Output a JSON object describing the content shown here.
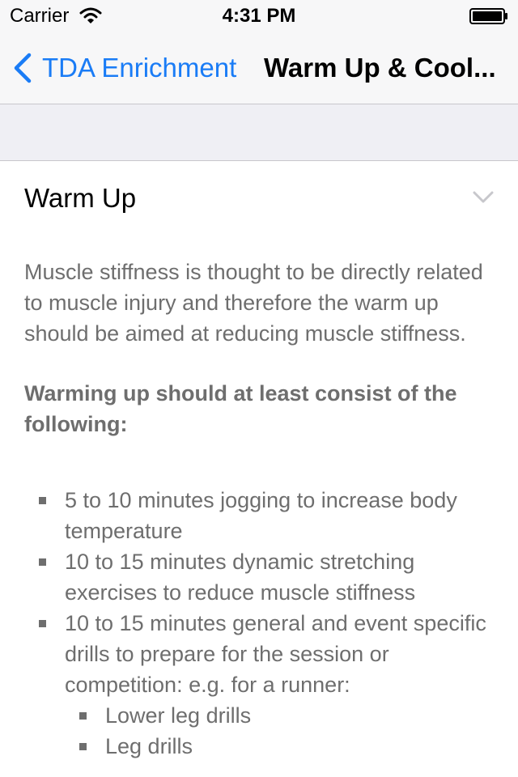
{
  "status_bar": {
    "carrier": "Carrier",
    "time": "4:31 PM",
    "wifi_icon": "wifi-icon",
    "battery_icon": "battery-icon"
  },
  "nav_bar": {
    "back_label": "TDA Enrichment",
    "back_icon": "chevron-left-icon",
    "title": "Warm Up & Cool..."
  },
  "section": {
    "title": "Warm Up",
    "expand_icon": "chevron-down-icon",
    "intro": "Muscle stiffness is thought to be directly related to muscle injury and therefore the warm up should be aimed at reducing muscle stiffness.",
    "subheading": "Warming up should at least consist of the following:",
    "items": [
      {
        "text": "5 to 10 minutes jogging to increase body temperature"
      },
      {
        "text": "10 to 15 minutes dynamic stretching exercises to reduce muscle stiffness"
      },
      {
        "text": "10 to 15 minutes general and event specific drills to prepare for the session or competition: e.g. for a runner:"
      }
    ],
    "subitems": [
      {
        "text": "Lower leg drills"
      },
      {
        "text": "Leg drills"
      }
    ]
  },
  "colors": {
    "accent": "#1a7cf6",
    "body_text": "#6e6e6e",
    "band": "#efeff4",
    "nav_background": "#f7f7f8"
  }
}
